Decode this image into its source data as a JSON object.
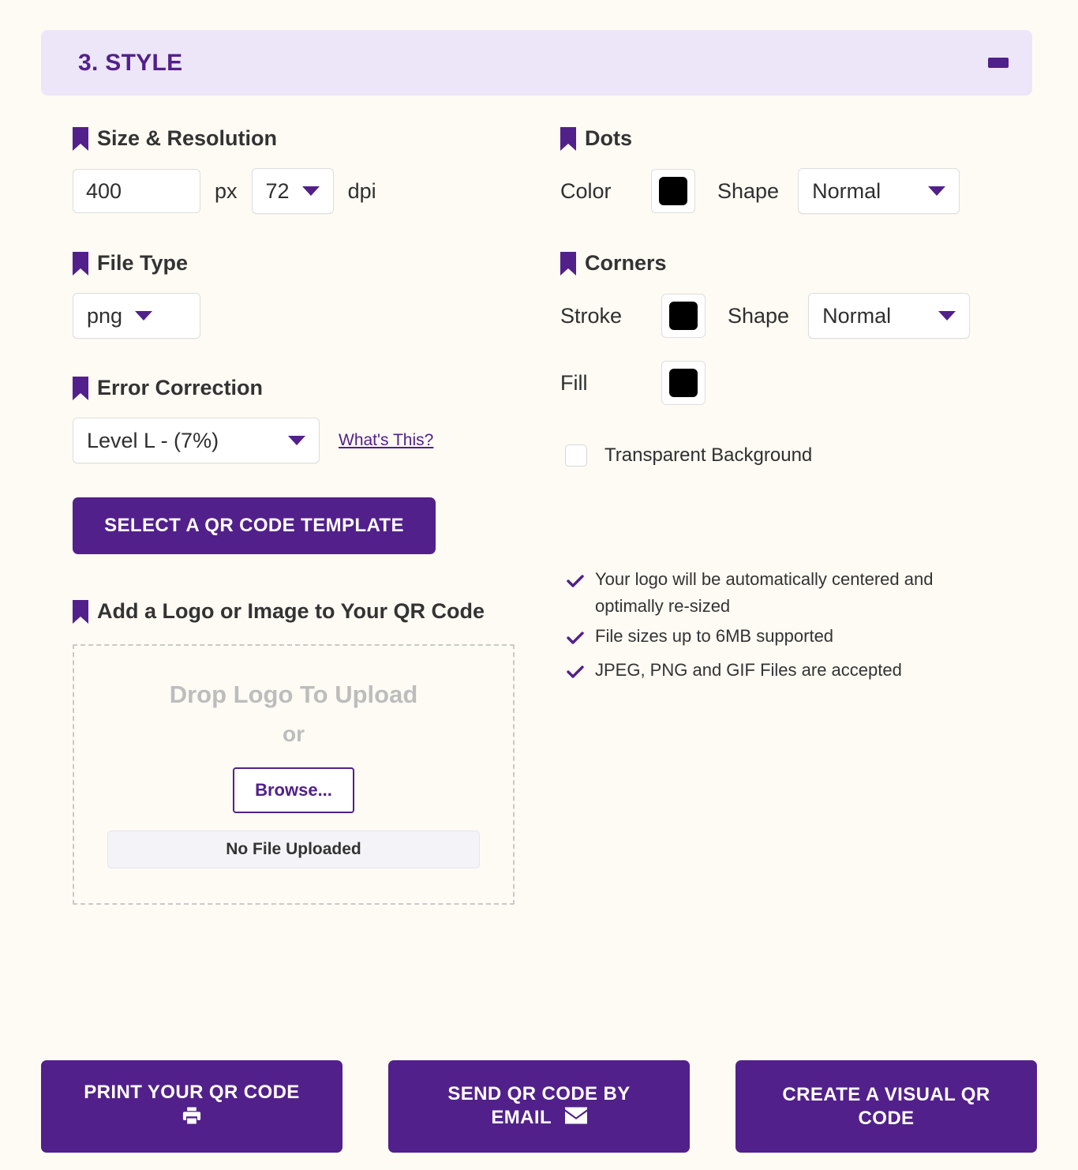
{
  "section": {
    "title": "3. STYLE",
    "collapse_symbol": "-"
  },
  "size_resolution": {
    "label": "Size & Resolution",
    "px_value": "400",
    "px_placeholder": "400",
    "px_unit": "px",
    "dpi_value": "72",
    "dpi_unit": "dpi"
  },
  "file_type": {
    "label": "File Type",
    "value": "png"
  },
  "error_correction": {
    "label": "Error Correction",
    "value": "Level L - (7%)",
    "help_link": "What's This?"
  },
  "template_button": {
    "label": "SELECT A QR CODE TEMPLATE"
  },
  "dots": {
    "label": "Dots",
    "color_label": "Color",
    "color_value": "#000000",
    "shape_label": "Shape",
    "shape_value": "Normal"
  },
  "corners": {
    "label": "Corners",
    "stroke_label": "Stroke",
    "stroke_value": "#000000",
    "shape_label": "Shape",
    "shape_value": "Normal",
    "fill_label": "Fill",
    "fill_value": "#000000"
  },
  "transparent_background": {
    "label": "Transparent Background",
    "checked": false
  },
  "logo": {
    "label": "Add a Logo or Image to Your QR Code",
    "drop_text": "Drop Logo To Upload",
    "or_text": "or",
    "browse_label": "Browse...",
    "file_status": "No File Uploaded",
    "features": [
      "Your logo will be automatically centered and optimally re-sized",
      "File sizes up to 6MB supported",
      "JPEG, PNG and GIF Files are accepted"
    ]
  },
  "actions": {
    "print": {
      "line1": "PRINT YOUR QR CODE",
      "icon": "printer-icon"
    },
    "email": {
      "line1": "SEND QR CODE BY",
      "line2": "EMAIL",
      "icon": "envelope-icon"
    },
    "visual": {
      "line1": "CREATE A VISUAL QR",
      "line2": "CODE"
    }
  },
  "colors": {
    "brand_purple": "#52208a",
    "header_bg": "#ede6f8",
    "page_bg": "#fdfbf4"
  }
}
